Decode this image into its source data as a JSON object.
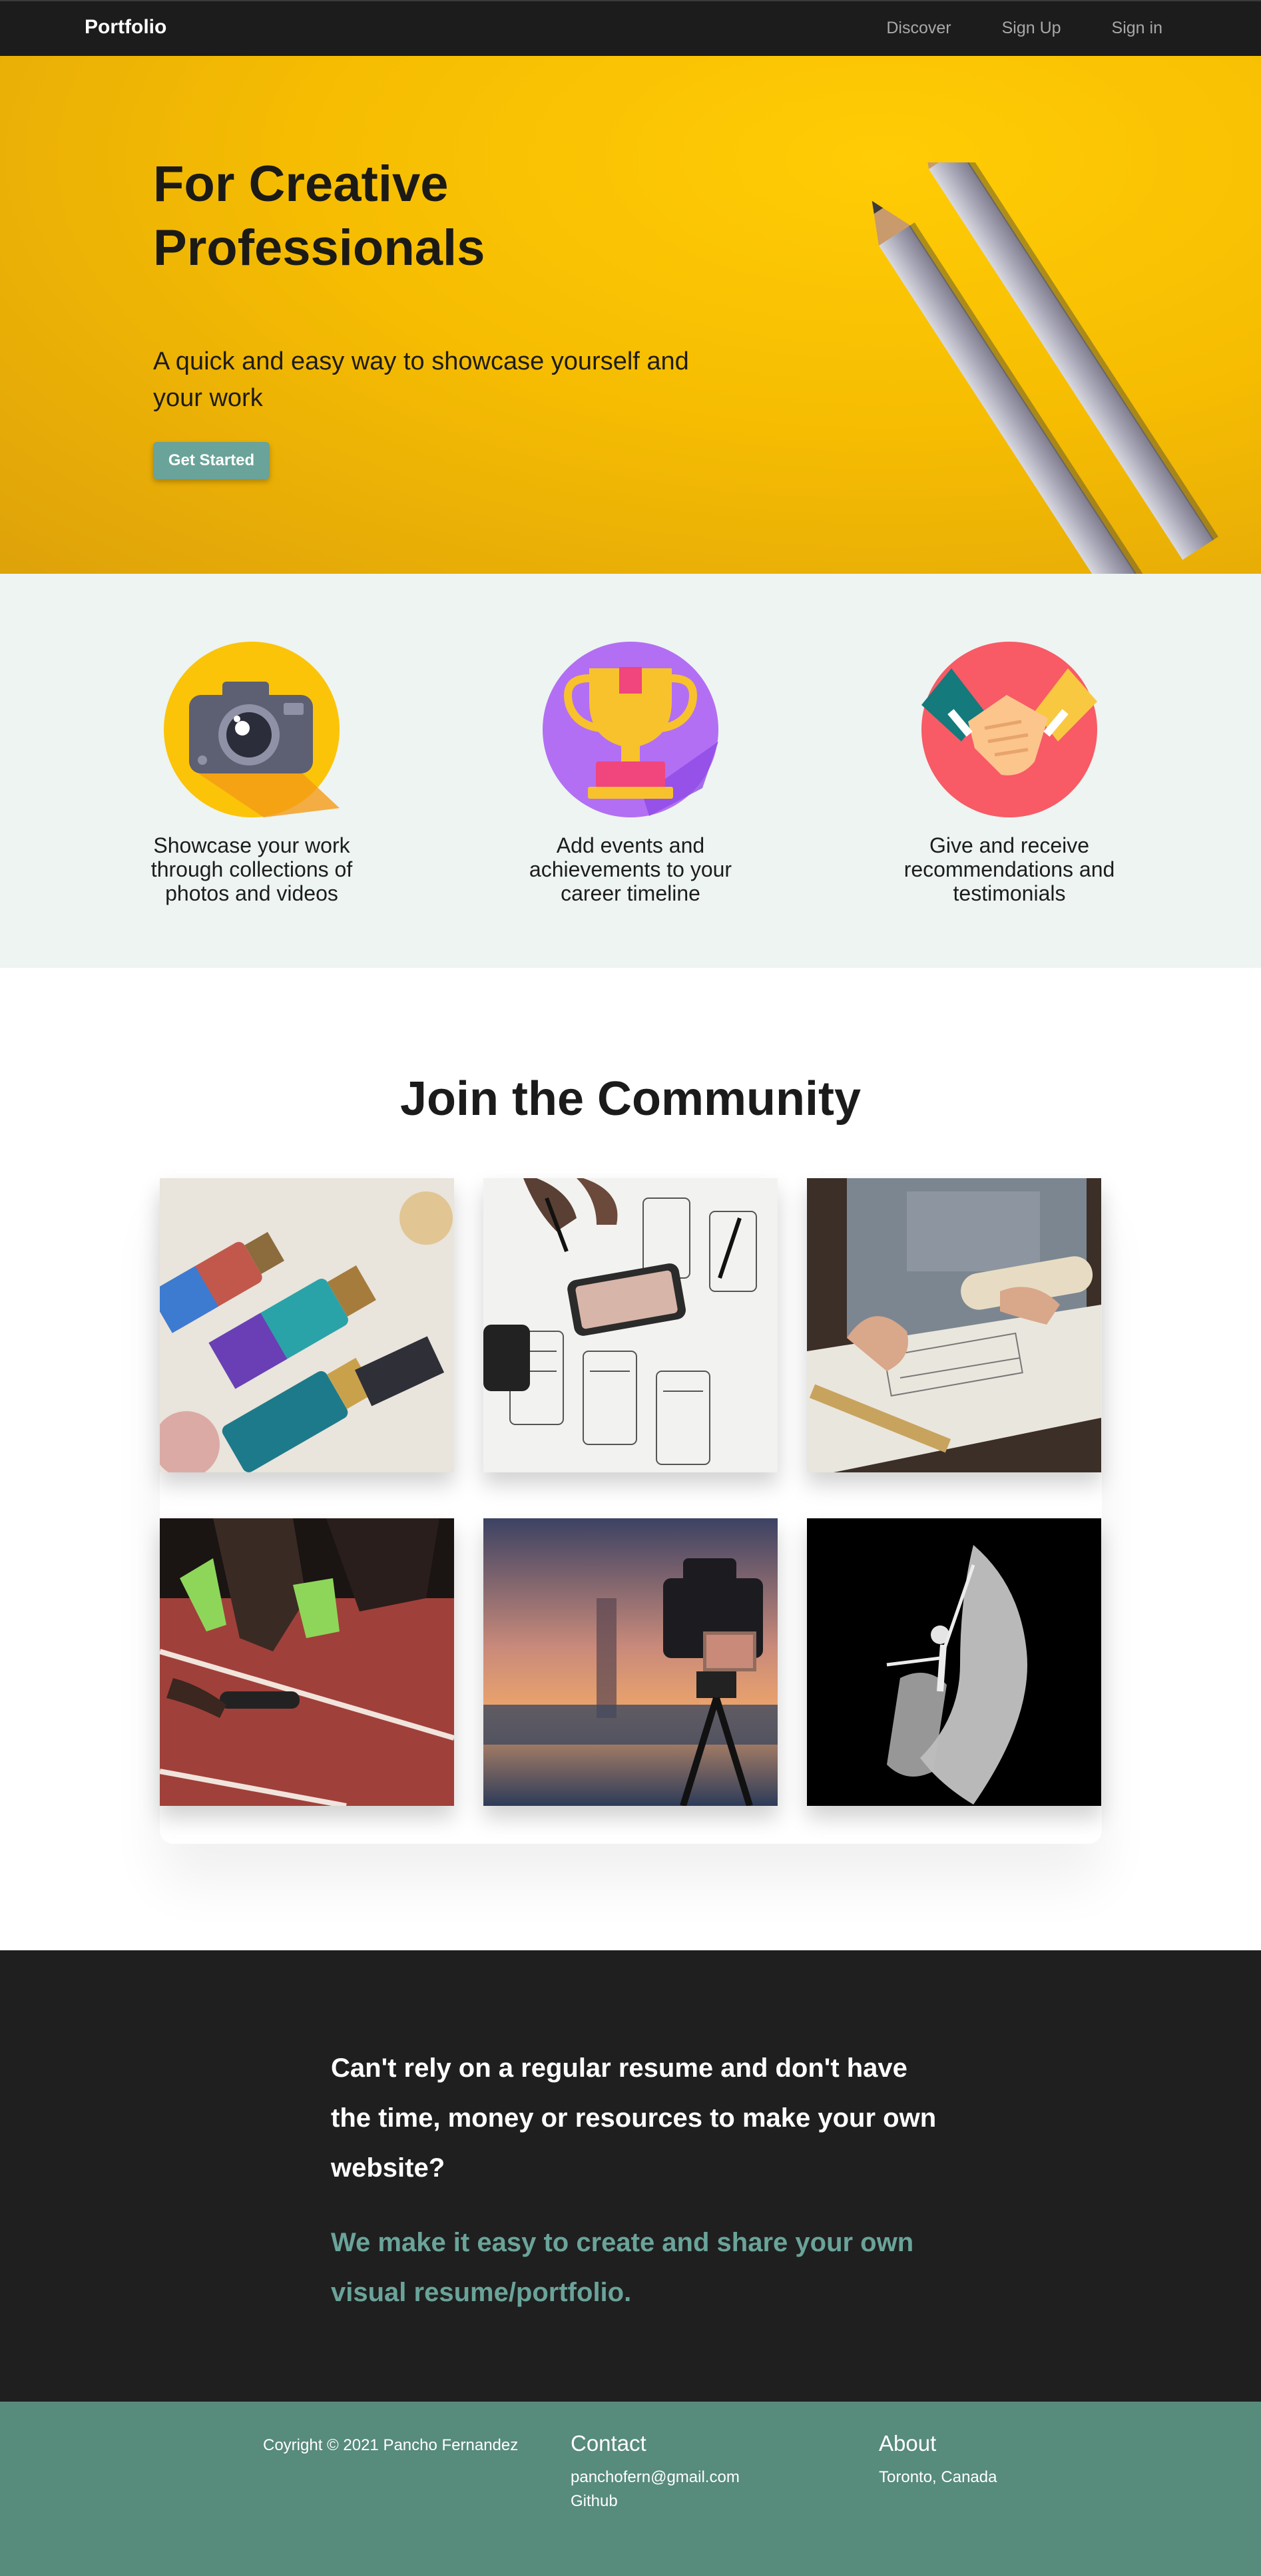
{
  "nav": {
    "brand": "Portfolio",
    "links": [
      "Discover",
      "Sign Up",
      "Sign in"
    ]
  },
  "hero": {
    "title": "For Creative Professionals",
    "subtitle": "A quick and easy way to showcase yourself and your work",
    "cta_label": "Get Started",
    "background_color": "#f6bd02"
  },
  "features": [
    {
      "icon": "camera-icon",
      "text": "Showcase your work through collections of photos and videos"
    },
    {
      "icon": "trophy-icon",
      "text": "Add events and achievements to your career timeline"
    },
    {
      "icon": "handshake-icon",
      "text": "Give and receive recommendations and testimonials"
    }
  ],
  "community": {
    "title": "Join the Community",
    "tiles": [
      "paint-brushes-photo",
      "wireframe-sketch-photo",
      "architect-drawing-photo",
      "sprinter-start-photo",
      "camera-tripod-photo",
      "dancer-photo"
    ]
  },
  "cta": {
    "main": "Can't rely on a regular resume and don't have the time, money or resources to make your own website?",
    "accent": "We make it easy to create and share your own visual resume/portfolio.",
    "accent_color": "#6aa399"
  },
  "footer": {
    "copyright": "Coyright © 2021 Pancho Fernandez",
    "contact": {
      "heading": "Contact",
      "email": "panchofern@gmail.com",
      "github": "Github"
    },
    "about": {
      "heading": "About",
      "location": "Toronto, Canada"
    },
    "background_color": "#578b7c"
  }
}
